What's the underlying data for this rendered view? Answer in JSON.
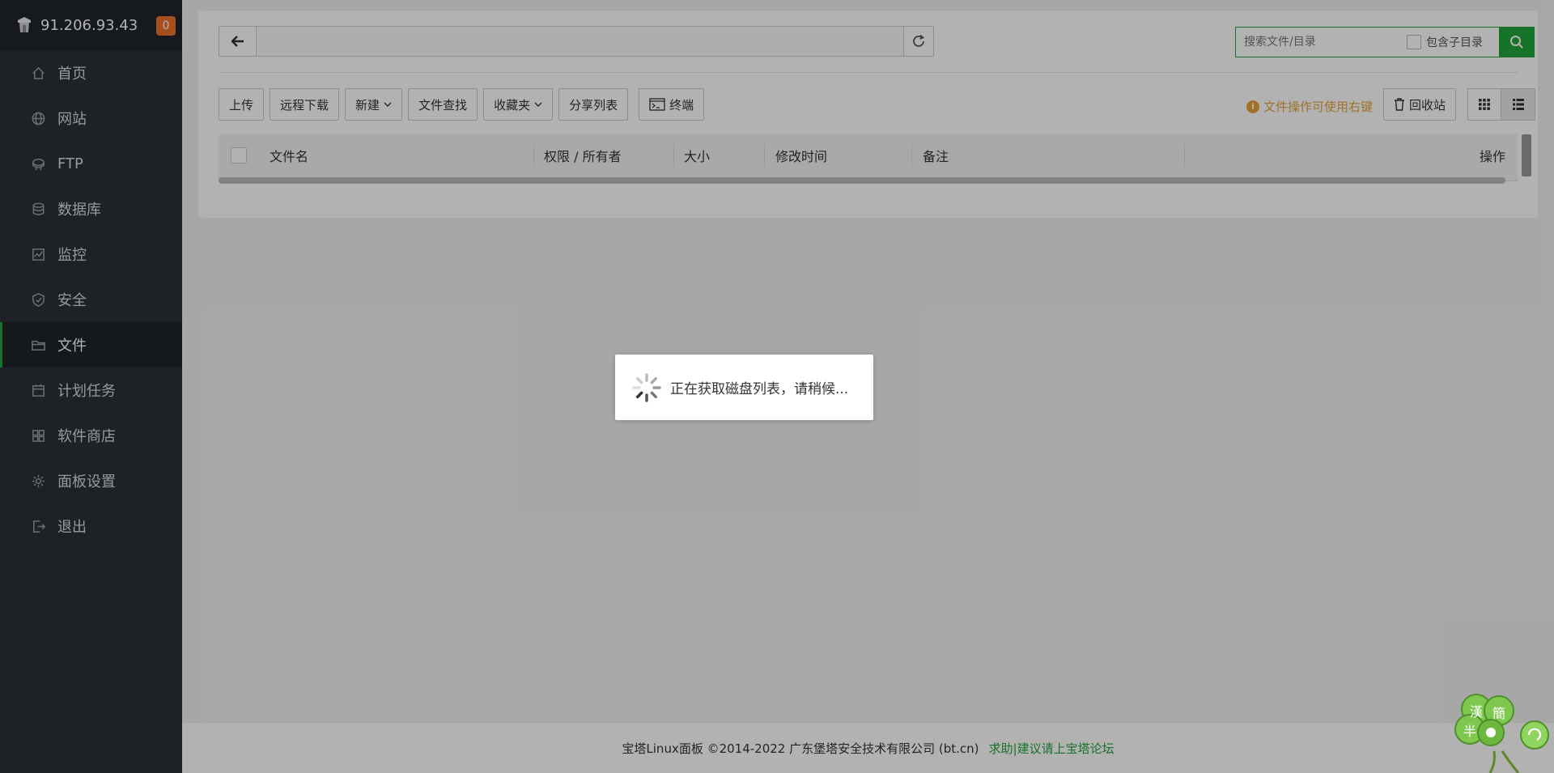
{
  "sidebar": {
    "server_ip": "91.206.93.43",
    "notification_count": "0",
    "items": [
      {
        "label": "首页",
        "icon": "home-icon"
      },
      {
        "label": "网站",
        "icon": "globe-icon"
      },
      {
        "label": "FTP",
        "icon": "ftp-icon"
      },
      {
        "label": "数据库",
        "icon": "database-icon"
      },
      {
        "label": "监控",
        "icon": "monitor-icon"
      },
      {
        "label": "安全",
        "icon": "shield-icon"
      },
      {
        "label": "文件",
        "icon": "folder-icon",
        "active": true
      },
      {
        "label": "计划任务",
        "icon": "calendar-icon"
      },
      {
        "label": "软件商店",
        "icon": "apps-icon"
      },
      {
        "label": "面板设置",
        "icon": "gear-icon"
      },
      {
        "label": "退出",
        "icon": "logout-icon"
      }
    ]
  },
  "path": {
    "value": ""
  },
  "search": {
    "placeholder": "搜索文件/目录",
    "include_subdirs_label": "包含子目录"
  },
  "toolbar": {
    "upload": "上传",
    "remote_download": "远程下载",
    "new": "新建",
    "file_search": "文件查找",
    "favorites": "收藏夹",
    "share_list": "分享列表",
    "terminal": "终端"
  },
  "hint": "文件操作可使用右键",
  "recycle_bin": "回收站",
  "table": {
    "columns": [
      "文件名",
      "权限 / 所有者",
      "大小",
      "修改时间",
      "备注",
      "操作"
    ]
  },
  "footer": {
    "copyright": "宝塔Linux面板 ©2014-2022 广东堡塔安全技术有限公司 (bt.cn)",
    "link": "求助|建议请上宝塔论坛"
  },
  "loading": {
    "message": "正在获取磁盘列表，请稍候..."
  },
  "widget": {
    "chars": [
      "漢",
      "簡",
      "半"
    ]
  },
  "colors": {
    "accent": "#20a53a",
    "sidebar_bg": "#2c3138",
    "badge": "#f0702a",
    "hint": "#e6a23c"
  }
}
